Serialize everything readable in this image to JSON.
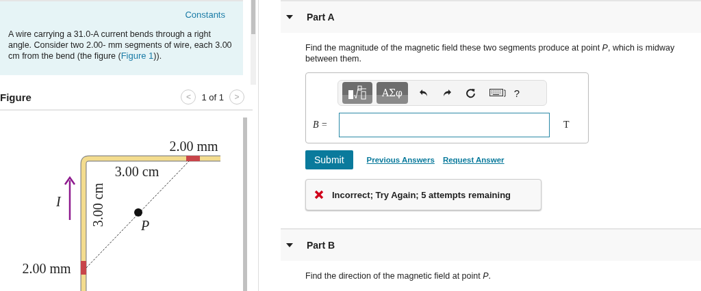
{
  "problem": {
    "constants_link": "Constants",
    "text": "A wire carrying a 31.0-A current bends through a right angle. Consider two 2.00- mm segments of wire, each 3.00 cm from the bend (the figure (",
    "figure_link": "Figure 1",
    "text_end": "))."
  },
  "figure": {
    "title": "Figure",
    "prev": "<",
    "pager": "1 of 1",
    "next": ">",
    "labels": {
      "top_segment": "2.00 mm",
      "top_distance": "3.00 cm",
      "side_distance": "3.00 cm",
      "side_segment": "2.00 mm",
      "current": "I",
      "point": "P"
    }
  },
  "parts": [
    {
      "title": "Part A",
      "expanded": true,
      "question": "Find the magnitude of the magnetic field these two segments produce at point *P*, which is midway between them.",
      "toolbar": {
        "greek": "ΑΣφ",
        "help": "?"
      },
      "answer": {
        "label": "B =",
        "unit": "T"
      },
      "actions": {
        "submit": "Submit",
        "links": [
          "Previous Answers",
          "Request Answer"
        ]
      },
      "feedback": {
        "kind": "incorrect",
        "text": "Incorrect; Try Again; 5 attempts remaining"
      }
    },
    {
      "title": "Part B",
      "expanded": true,
      "question": "Find the direction of the magnetic field at point *P*."
    }
  ]
}
